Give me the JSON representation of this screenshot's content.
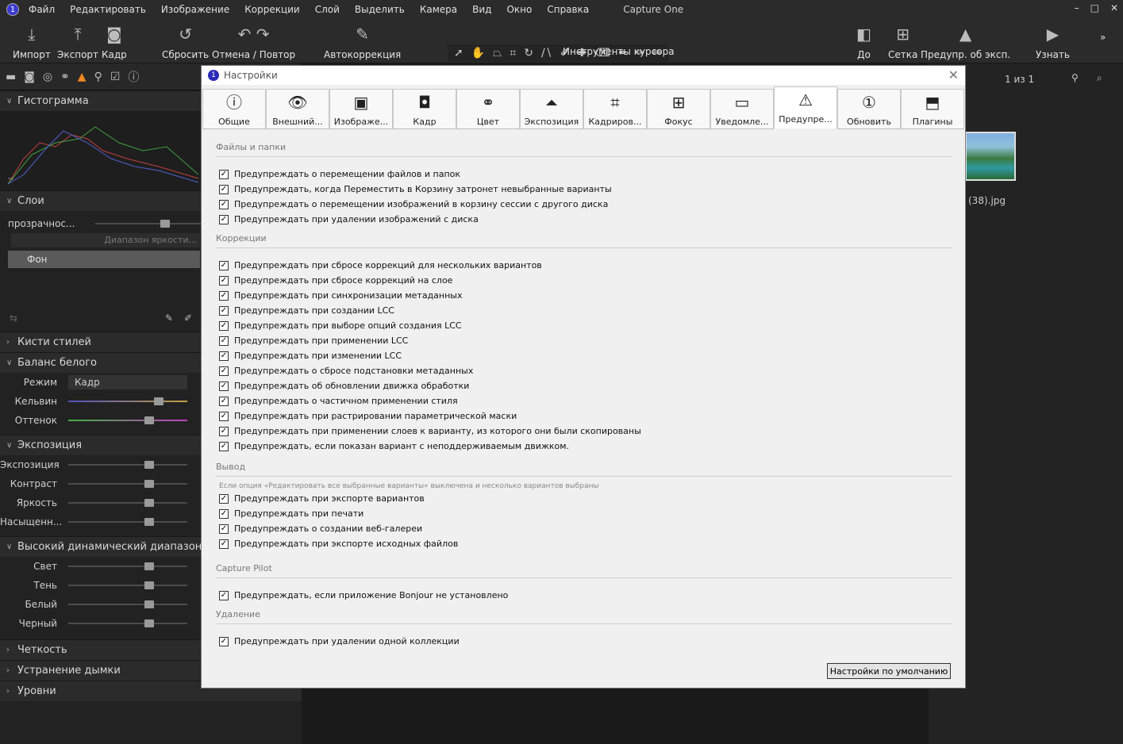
{
  "menubar": {
    "logo": "1",
    "items": [
      "Файл",
      "Редактировать",
      "Изображение",
      "Коррекции",
      "Слой",
      "Выделить",
      "Камера",
      "Вид",
      "Окно",
      "Справка"
    ],
    "title": "Capture One",
    "controls": [
      "–",
      "□",
      "✕"
    ]
  },
  "toolbar": {
    "import": "Импорт",
    "export": "Экспорт",
    "capture": "Кадр",
    "reset": "Сбросить",
    "undo_redo": "Отмена / Повтор",
    "autoadjust": "Автокоррекция",
    "cursor_tools": "Инструменты курсора",
    "before": "До",
    "grid": "Сетка",
    "exposure_warning": "Предупр. об эксп.",
    "learn": "Узнать",
    "more": "»"
  },
  "left": {
    "histogram": "Гистограмма",
    "hist_value": "--",
    "layers": "Слои",
    "opacity": "прозрачнос...",
    "luma_range": "Диапазон яркости...",
    "background_layer": "Фон",
    "style_brushes": "Кисти стилей",
    "white_balance": "Баланс белого",
    "wb_mode_label": "Режим",
    "wb_mode_value": "Кадр",
    "kelvin": "Кельвин",
    "tint": "Оттенок",
    "exposure_section": "Экспозиция",
    "exposure": "Экспозиция",
    "contrast": "Контраст",
    "brightness": "Яркость",
    "saturation": "Насыщенн...",
    "hdr": "Высокий динамический диапазон",
    "highlight": "Свет",
    "shadow": "Тень",
    "white": "Белый",
    "black": "Черный",
    "clarity": "Четкость",
    "dehaze": "Устранение дымки",
    "levels": "Уровни"
  },
  "right": {
    "counter": "1 из 1",
    "filename": "(38).jpg"
  },
  "dialog": {
    "title": "Настройки",
    "tabs": [
      {
        "label": "Общие",
        "icon": "ⓘ"
      },
      {
        "label": "Внешний...",
        "icon": "👁"
      },
      {
        "label": "Изображе...",
        "icon": "▣"
      },
      {
        "label": "Кадр",
        "icon": "◘"
      },
      {
        "label": "Цвет",
        "icon": "⚭"
      },
      {
        "label": "Экспозиция",
        "icon": "⏶"
      },
      {
        "label": "Кадриров...",
        "icon": "⌗"
      },
      {
        "label": "Фокус",
        "icon": "⊞"
      },
      {
        "label": "Уведомле...",
        "icon": "▭"
      },
      {
        "label": "Предупре...",
        "icon": "⚠"
      },
      {
        "label": "Обновить",
        "icon": "①"
      },
      {
        "label": "Плагины",
        "icon": "⬒"
      }
    ],
    "groups": [
      {
        "title": "Файлы и папки",
        "items": [
          "Предупреждать о перемещении файлов и папок",
          "Предупреждать, когда Переместить в Корзину затронет невыбранные варианты",
          "Предупреждать о перемещении изображений в корзину сессии с другого диска",
          "Предупреждать при удалении изображений с диска"
        ]
      },
      {
        "title": "Коррекции",
        "items": [
          "Предупреждать при сбросе коррекций для нескольких вариантов",
          "Предупреждать при сбросе коррекций на слое",
          "Предупреждать при синхронизации метаданных",
          "Предупреждать при создании LCC",
          "Предупреждать при выборе опций создания LCC",
          "Предупреждать при применении LCC",
          "Предупреждать при изменении LCC",
          "Предупреждать о сбросе подстановки метаданных",
          "Предупреждать об обновлении движка обработки",
          "Предупреждать о частичном применении стиля",
          "Предупреждать при растрировании параметрической маски",
          "Предупреждать при применении слоев к варианту, из которого они были скопированы",
          "Предупреждать, если показан вариант с неподдерживаемым движком."
        ]
      },
      {
        "title": "Вывод",
        "note": "Если опция «Редактировать все выбранные варианты» выключена и несколько вариантов выбраны",
        "items": [
          "Предупреждать при экспорте вариантов",
          "Предупреждать при печати",
          "Предупреждать о создании веб-галереи",
          "Предупреждать при экспорте исходных файлов"
        ]
      },
      {
        "title": "Capture Pilot",
        "items": [
          "Предупреждать, если приложение Bonjour не установлено"
        ]
      },
      {
        "title": "Удаление",
        "items": [
          "Предупреждать при удалении одной коллекции"
        ]
      }
    ],
    "defaults_button": "Настройки по умолчанию",
    "check": "✓"
  }
}
